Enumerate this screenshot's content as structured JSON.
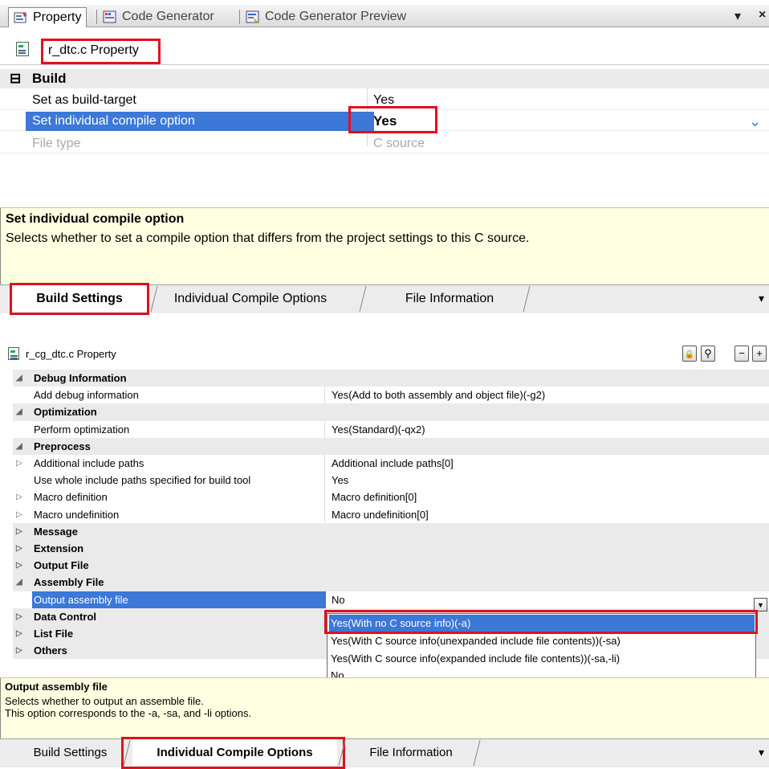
{
  "top_panel": {
    "tabs": [
      {
        "label": "Property",
        "icon": "property-icon",
        "active": true
      },
      {
        "label": "Code Generator",
        "icon": "code-generator-icon",
        "active": false
      },
      {
        "label": "Code Generator Preview",
        "icon": "code-generator-preview-icon",
        "active": false
      }
    ],
    "window_controls": {
      "dropdown": "▾",
      "close": "×"
    },
    "property_title": "r_dtc.c Property",
    "category": {
      "label": "Build",
      "toggle": "⊟"
    },
    "rows": [
      {
        "name": "Set as build-target",
        "value": "Yes",
        "state": "normal"
      },
      {
        "name": "Set individual compile option",
        "value": "Yes",
        "state": "selected"
      },
      {
        "name": "File type",
        "value": "C source",
        "state": "disabled"
      }
    ],
    "dropdown_glyph": "⌄",
    "description": {
      "title": "Set individual compile option",
      "text": "Selects whether to set a compile option that differs from the project settings to this C source."
    },
    "bottom_tabs": [
      "Build Settings",
      "Individual Compile Options",
      "File Information"
    ],
    "bottom_tabs_active": "Build Settings",
    "tab_menu_glyph": "▾"
  },
  "bottom_panel": {
    "property_title": "r_cg_dtc.c Property",
    "toolbar": {
      "lock": "🔒",
      "search": "⚲",
      "collapse": "−",
      "expand": "+"
    },
    "rows": [
      {
        "type": "cat",
        "tri": "◢",
        "name": "Debug Information"
      },
      {
        "type": "prop",
        "name": "Add debug information",
        "value": "Yes(Add to both assembly and object file)(-g2)"
      },
      {
        "type": "cat",
        "tri": "◢",
        "name": "Optimization"
      },
      {
        "type": "prop",
        "name": "Perform optimization",
        "value": "Yes(Standard)(-qx2)"
      },
      {
        "type": "cat",
        "tri": "◢",
        "name": "Preprocess"
      },
      {
        "type": "prop",
        "tri": "▷",
        "name": "Additional include paths",
        "value": "Additional include paths[0]"
      },
      {
        "type": "prop",
        "name": "Use whole include paths specified for build tool",
        "value": "Yes"
      },
      {
        "type": "prop",
        "tri": "▷",
        "name": "Macro definition",
        "value": "Macro definition[0]"
      },
      {
        "type": "prop",
        "tri": "▷",
        "name": "Macro undefinition",
        "value": "Macro undefinition[0]"
      },
      {
        "type": "cat",
        "tri": "▷",
        "name": "Message"
      },
      {
        "type": "cat",
        "tri": "▷",
        "name": "Extension"
      },
      {
        "type": "cat",
        "tri": "▷",
        "name": "Output File"
      },
      {
        "type": "cat",
        "tri": "◢",
        "name": "Assembly File"
      },
      {
        "type": "sel",
        "name": "Output assembly file",
        "value": "No"
      },
      {
        "type": "cat",
        "tri": "▷",
        "name": "Data Control"
      },
      {
        "type": "cat",
        "tri": "▷",
        "name": "List File"
      },
      {
        "type": "cat",
        "tri": "▷",
        "name": "Others"
      }
    ],
    "dropdown_options": [
      "Yes(With no C source info)(-a)",
      "Yes(With C source info(unexpanded include file contents))(-sa)",
      "Yes(With C source info(expanded include file contents))(-sa,-li)",
      "No"
    ],
    "dropdown_btn": "▼",
    "description": {
      "title": "Output assembly file",
      "line1": "Selects whether to output an assemble file.",
      "line2": "This option corresponds to the -a, -sa, and -li options."
    },
    "bottom_tabs": [
      "Build Settings",
      "Individual Compile Options",
      "File Information"
    ],
    "bottom_tabs_active": "Individual Compile Options",
    "tab_menu_glyph": "▾"
  },
  "colors": {
    "selection": "#3b78d8",
    "highlight_box": "#e0101c",
    "description_bg": "#ffffe1"
  }
}
